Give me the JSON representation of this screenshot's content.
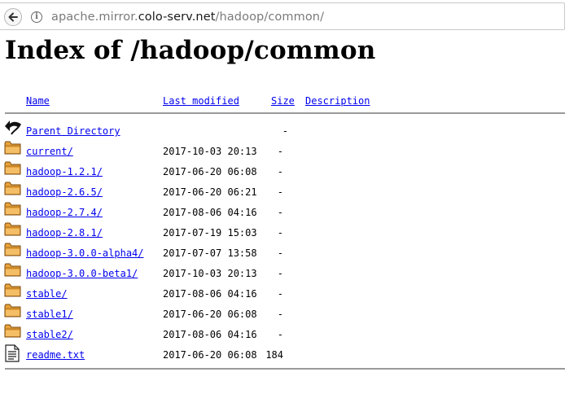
{
  "browser": {
    "url_prefix": "apache.mirror.",
    "url_host": "colo-serv.net",
    "url_path": "/hadoop/common/"
  },
  "page": {
    "title": "Index of /hadoop/common"
  },
  "table": {
    "headers": {
      "name": "Name",
      "last_modified": "Last modified",
      "size": "Size",
      "description": "Description"
    },
    "rows": [
      {
        "icon": "back-icon",
        "name": "Parent Directory",
        "date": "",
        "size": "-"
      },
      {
        "icon": "folder-icon",
        "name": "current/",
        "date": "2017-10-03 20:13",
        "size": "-"
      },
      {
        "icon": "folder-icon",
        "name": "hadoop-1.2.1/",
        "date": "2017-06-20 06:08",
        "size": "-"
      },
      {
        "icon": "folder-icon",
        "name": "hadoop-2.6.5/",
        "date": "2017-06-20 06:21",
        "size": "-"
      },
      {
        "icon": "folder-icon",
        "name": "hadoop-2.7.4/",
        "date": "2017-08-06 04:16",
        "size": "-"
      },
      {
        "icon": "folder-icon",
        "name": "hadoop-2.8.1/",
        "date": "2017-07-19 15:03",
        "size": "-"
      },
      {
        "icon": "folder-icon",
        "name": "hadoop-3.0.0-alpha4/",
        "date": "2017-07-07 13:58",
        "size": "-"
      },
      {
        "icon": "folder-icon",
        "name": "hadoop-3.0.0-beta1/",
        "date": "2017-10-03 20:13",
        "size": "-"
      },
      {
        "icon": "folder-icon",
        "name": "stable/",
        "date": "2017-08-06 04:16",
        "size": "-"
      },
      {
        "icon": "folder-icon",
        "name": "stable1/",
        "date": "2017-06-20 06:08",
        "size": "-"
      },
      {
        "icon": "folder-icon",
        "name": "stable2/",
        "date": "2017-08-06 04:16",
        "size": "-"
      },
      {
        "icon": "text-file-icon",
        "name": "readme.txt",
        "date": "2017-06-20 06:08",
        "size": "184"
      }
    ]
  },
  "colors": {
    "link": "#0000ee",
    "folder": "#e8a33a"
  }
}
